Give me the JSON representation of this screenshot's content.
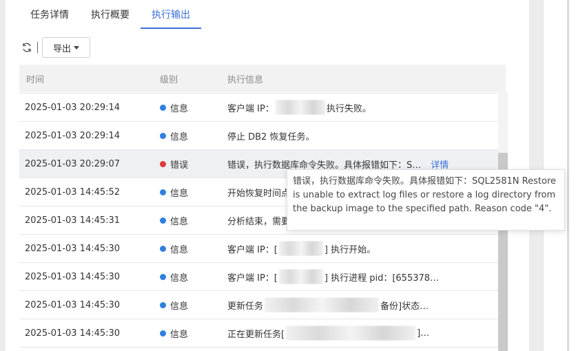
{
  "tabs": [
    "任务详情",
    "执行概要",
    "执行输出"
  ],
  "active_tab": "执行输出",
  "toolbar": {
    "export_label": "导出"
  },
  "table": {
    "columns": [
      "时间",
      "级别",
      "执行信息"
    ],
    "rows": [
      {
        "time": "2025-01-03 20:29:14",
        "level": "信息",
        "level_color": "#2f7fe0",
        "msg_pre": "客户端 IP：",
        "msg_post": " 执行失败。"
      },
      {
        "time": "2025-01-03 20:29:14",
        "level": "信息",
        "level_color": "#2f7fe0",
        "msg_pre": "停止 DB2 恢复任务。",
        "msg_post": ""
      },
      {
        "time": "2025-01-03 20:29:07",
        "level": "错误",
        "level_color": "#e03a3a",
        "msg_pre": "错误，执行数据库命令失败。具体报错如下：S…",
        "msg_post": "",
        "link": "详情"
      },
      {
        "time": "2025-01-03 14:45:52",
        "level": "信息",
        "level_color": "#2f7fe0",
        "msg_pre": "开始恢复时间点",
        "msg_post": ""
      },
      {
        "time": "2025-01-03 14:45:31",
        "level": "信息",
        "level_color": "#2f7fe0",
        "msg_pre": "分析结束，需要",
        "msg_post": ""
      },
      {
        "time": "2025-01-03 14:45:30",
        "level": "信息",
        "level_color": "#2f7fe0",
        "msg_pre": "客户端 IP：[",
        "msg_post": "] 执行开始。"
      },
      {
        "time": "2025-01-03 14:45:30",
        "level": "信息",
        "level_color": "#2f7fe0",
        "msg_pre": "客户端 IP：[",
        "msg_post": "] 执行进程 pid：[655378…"
      },
      {
        "time": "2025-01-03 14:45:30",
        "level": "信息",
        "level_color": "#2f7fe0",
        "msg_pre": "更新任务",
        "msg_post": "备份]状态…"
      },
      {
        "time": "2025-01-03 14:45:30",
        "level": "信息",
        "level_color": "#2f7fe0",
        "msg_pre": "正在更新任务[",
        "msg_post": "]…"
      }
    ]
  },
  "tooltip": {
    "text": "错误，执行数据库命令失败。具体报错如下：SQL2581N Restore is unable to extract log files or restore a log directory from the backup image to the specified path. Reason code \"4\"."
  }
}
